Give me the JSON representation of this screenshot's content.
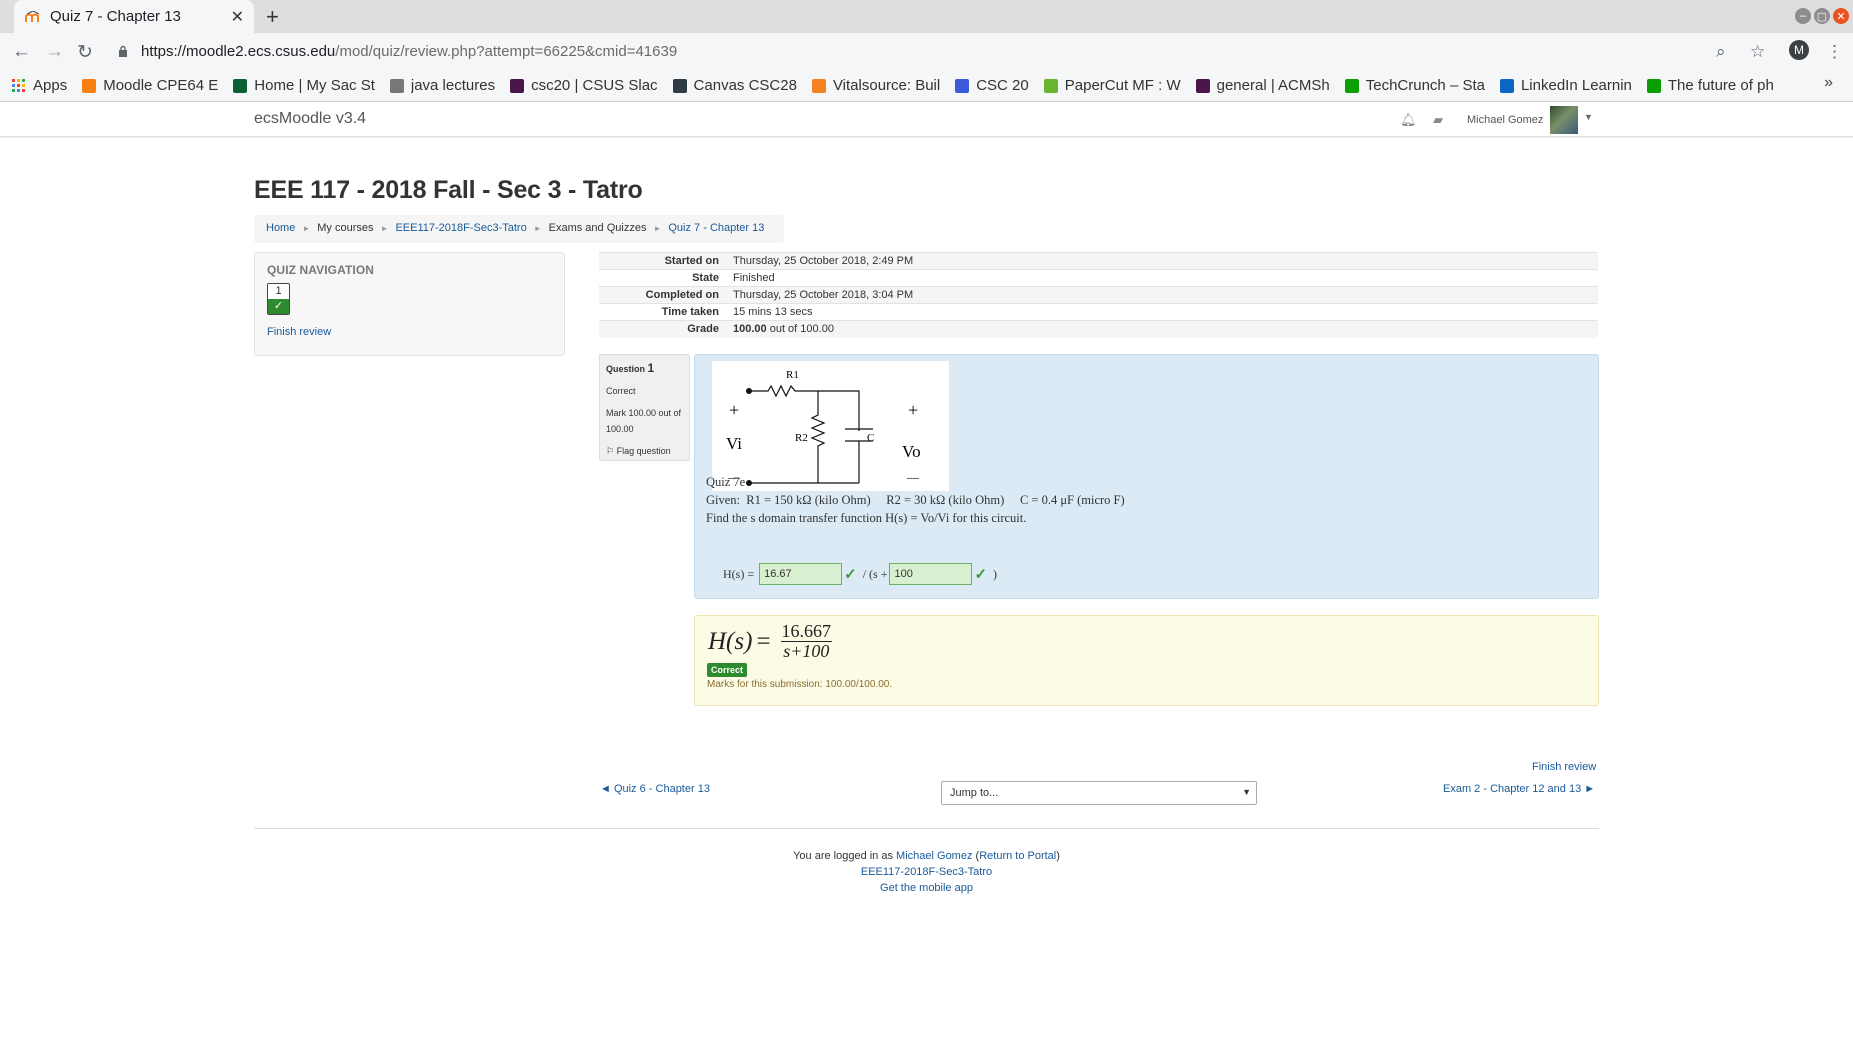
{
  "browser": {
    "tab_title": "Quiz 7 - Chapter 13",
    "url_host": "https://moodle2.ecs.csus.edu",
    "url_path": "/mod/quiz/review.php?attempt=66225&cmid=41639",
    "profile_initial": "M",
    "bookmarks": [
      {
        "label": "Apps",
        "color": "#e8453c"
      },
      {
        "label": "Moodle CPE64 E",
        "color": "#f98012"
      },
      {
        "label": "Home | My Sac St",
        "color": "#0b5f34"
      },
      {
        "label": "java lectures",
        "color": "#777777"
      },
      {
        "label": "csc20 | CSUS Slac",
        "color": "#4a154b"
      },
      {
        "label": "Canvas CSC28",
        "color": "#2d3b45"
      },
      {
        "label": "Vitalsource: Buil",
        "color": "#f58220"
      },
      {
        "label": "CSC 20",
        "color": "#3b5bdb"
      },
      {
        "label": "PaperCut MF : W",
        "color": "#69b42e"
      },
      {
        "label": "general | ACMSh",
        "color": "#4a154b"
      },
      {
        "label": "TechCrunch – Sta",
        "color": "#0a9e01"
      },
      {
        "label": "LinkedIn Learnin",
        "color": "#0a66c2"
      },
      {
        "label": "The future of ph",
        "color": "#0a9e01"
      }
    ],
    "more": "»"
  },
  "navbar": {
    "brand": "ecsMoodle v3.4",
    "user_name": "Michael Gomez"
  },
  "page": {
    "title": "EEE 117 - 2018 Fall - Sec 3 - Tatro",
    "breadcrumbs": [
      "Home",
      "My courses",
      "EEE117-2018F-Sec3-Tatro",
      "Exams and Quizzes",
      "Quiz 7 - Chapter 13"
    ]
  },
  "quiz_nav": {
    "heading": "QUIZ NAVIGATION",
    "question_number": "1",
    "finish_review": "Finish review"
  },
  "summary": [
    {
      "label": "Started on",
      "value": "Thursday, 25 October 2018, 2:49 PM"
    },
    {
      "label": "State",
      "value": "Finished"
    },
    {
      "label": "Completed on",
      "value": "Thursday, 25 October 2018, 3:04 PM"
    },
    {
      "label": "Time taken",
      "value": "15 mins 13 secs"
    },
    {
      "label": "Grade",
      "value_bold": "100.00",
      "value": " out of 100.00"
    }
  ],
  "question": {
    "label": "Question",
    "number": "1",
    "status": "Correct",
    "mark": "Mark 100.00 out of 100.00",
    "flag": "Flag question",
    "name": "Quiz 7e",
    "given_prefix": "Given:",
    "r1": "R1 = 150 kΩ (kilo Ohm)",
    "r2": "R2 = 30 kΩ (kilo Ohm)",
    "c": "C = 0.4 μF (micro F)",
    "prompt": "Find the s domain transfer function H(s) = Vo/Vi for this circuit.",
    "hs_label": "H(s) =",
    "answer1": "16.67",
    "mid_text": "/ (s +",
    "answer2": "100",
    "close_paren": ")"
  },
  "circuit": {
    "r1": "R1",
    "r2": "R2",
    "c": "C",
    "vi": "Vi",
    "vo": "Vo",
    "plus": "+",
    "minus": "—"
  },
  "feedback": {
    "lhs": "H(s)",
    "numerator": "16.667",
    "denominator": "s+100",
    "badge": "Correct",
    "marks": "Marks for this submission: 100.00/100.00."
  },
  "nav_links": {
    "finish_review": "Finish review",
    "prev": "◄ Quiz 6 - Chapter 13",
    "jump": "Jump to...",
    "next": "Exam 2 - Chapter 12 and 13 ►"
  },
  "footer": {
    "logged_prefix": "You are logged in as",
    "user": "Michael Gomez",
    "portal": "Return to Portal",
    "course": "EEE117-2018F-Sec3-Tatro",
    "app": "Get the mobile app"
  }
}
